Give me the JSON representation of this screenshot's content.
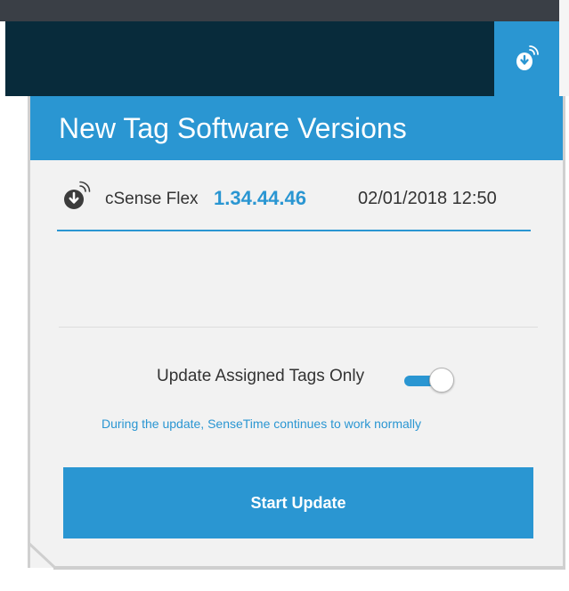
{
  "panel": {
    "title": "New Tag Software Versions"
  },
  "tags": [
    {
      "name": "cSense Flex",
      "version": "1.34.44.46",
      "datetime": "02/01/2018 12:50",
      "icon": "tag-device-icon"
    }
  ],
  "options": {
    "assigned_only_label": "Update Assigned Tags Only",
    "assigned_only_enabled": true,
    "info": "During the update, SenseTime continues to work normally"
  },
  "actions": {
    "start_update_label": "Start Update"
  },
  "colors": {
    "accent": "#2a96d2",
    "header_dark": "#082b3b",
    "panel_bg": "#f2f2f2",
    "text": "#333333"
  }
}
